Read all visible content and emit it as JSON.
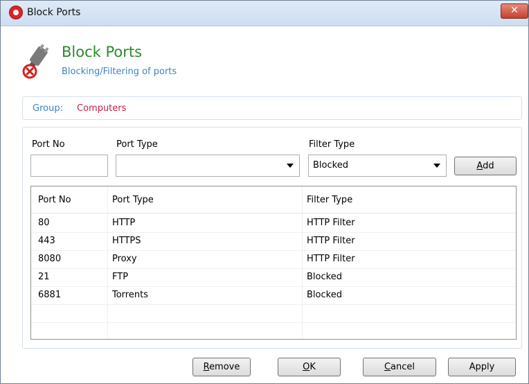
{
  "window": {
    "title": "Block Ports",
    "close_glyph": "✕"
  },
  "header": {
    "title": "Block Ports",
    "subtitle": "Blocking/Filtering of ports",
    "icon": "plug-blocked-icon"
  },
  "group": {
    "label": "Group:",
    "value": "Computers"
  },
  "form": {
    "port_no_label": "Port No",
    "port_no_value": "",
    "port_type_label": "Port Type",
    "port_type_value": "",
    "filter_type_label": "Filter Type",
    "filter_type_value": "Blocked",
    "add_label_u": "A",
    "add_label_rest": "dd"
  },
  "table": {
    "columns": [
      "Port No",
      "Port Type",
      "Filter Type"
    ],
    "rows": [
      [
        "80",
        "HTTP",
        "HTTP Filter"
      ],
      [
        "443",
        "HTTPS",
        "HTTP Filter"
      ],
      [
        "8080",
        "Proxy",
        "HTTP Filter"
      ],
      [
        "21",
        "FTP",
        "Blocked"
      ],
      [
        "6881",
        "Torrents",
        "Blocked"
      ]
    ]
  },
  "buttons": {
    "remove_u": "R",
    "remove_rest": "emove",
    "ok_u": "O",
    "ok_rest": "K",
    "cancel_u": "C",
    "cancel_rest": "ancel",
    "apply_u": "",
    "apply_rest": "Apply"
  },
  "colors": {
    "title_green": "#2a8a2a",
    "accent_blue": "#3b83c8",
    "group_value_red": "#c81e4a"
  }
}
